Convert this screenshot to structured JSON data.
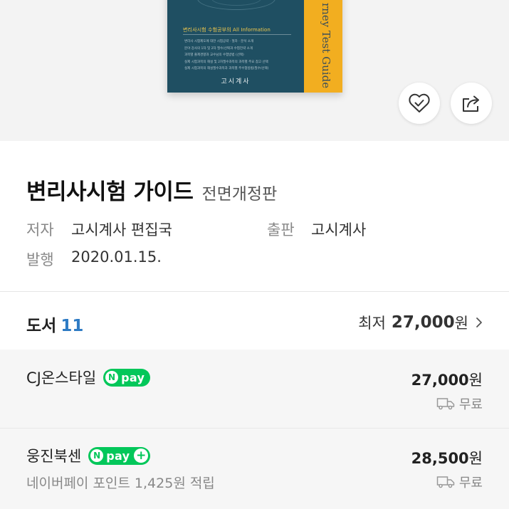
{
  "cover": {
    "subtitle": "변리사시험 수험공부의 All Information",
    "lines": [
      "변리사 시험제도에 대한 시험공략 · 절차 · 분석 소개",
      "분야 강사의 1차 및 2차 필수/선택과 수험전략 소개",
      "과목별 출제경향과 교수님의 수험방법 (선택)",
      "실제 시험과목의 해설 및 2차필수과목의 과목별 주요 참고 선택",
      "실제 시험과목의 해설필수과목과 과목별 주수험방법(필수/선택)"
    ],
    "publisher": "고시계사",
    "spine_text": "rney Test Guide",
    "colors": {
      "front": "#1f4f62",
      "spine": "#f2ae20"
    }
  },
  "actions": {
    "like_icon": "heart-check-icon",
    "share_icon": "share-icon"
  },
  "book": {
    "title": "변리사시험 가이드",
    "edition": "전면개정판",
    "author_label": "저자",
    "author": "고시계사 편집국",
    "publisher_label": "출판",
    "publisher": "고시계사",
    "date_label": "발행",
    "date": "2020.01.15."
  },
  "summary": {
    "category": "도서",
    "count": "11",
    "lowest_label": "최저",
    "lowest_price": "27,000",
    "currency": "원"
  },
  "sellers": [
    {
      "name": "CJ온스타일",
      "badge": "pay",
      "badge_n": "N",
      "price": "27,000",
      "currency": "원",
      "shipping": "무료"
    },
    {
      "name": "웅진북센",
      "badge": "pay",
      "badge_n": "N",
      "badge_plus": "+",
      "price": "28,500",
      "currency": "원",
      "shipping": "무료",
      "points": "네이버페이 포인트 1,425원 적립"
    }
  ],
  "accent_colors": {
    "npay": "#03c75a",
    "count": "#2e7bc4"
  }
}
